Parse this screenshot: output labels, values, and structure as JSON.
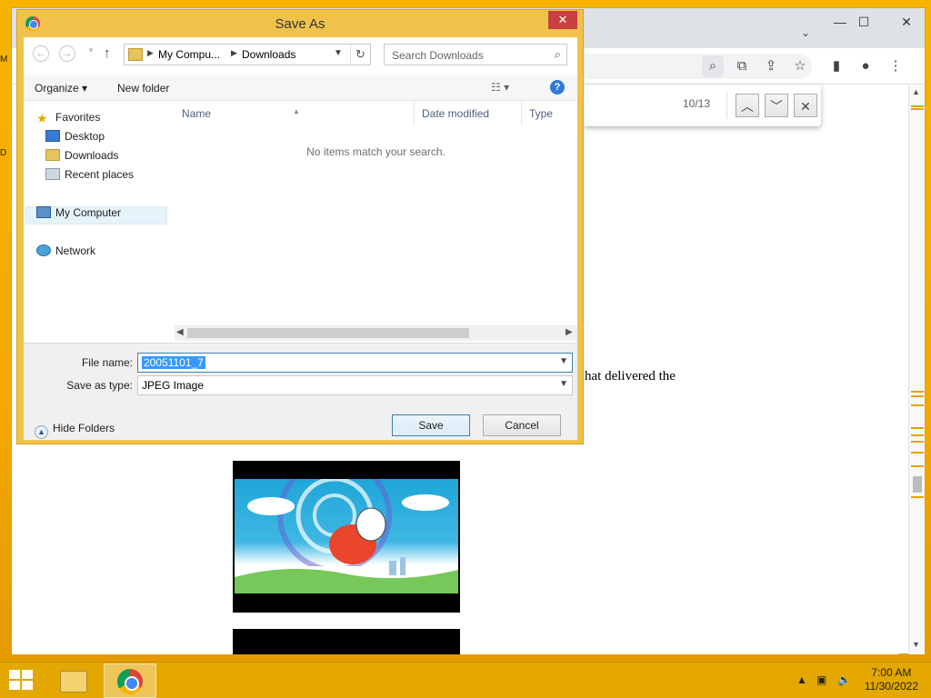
{
  "dialog": {
    "title": "Save As",
    "close_label": "✕",
    "nav": {
      "path_root": "My Compu...",
      "path_current": "Downloads",
      "search_placeholder": "Search Downloads"
    },
    "toolbar": {
      "organize_label": "Organize ▾",
      "new_folder_label": "New folder"
    },
    "nav_pane": {
      "favorites": "Favorites",
      "desktop": "Desktop",
      "downloads": "Downloads",
      "recent_places": "Recent places",
      "my_computer": "My Computer",
      "network": "Network"
    },
    "file_list": {
      "columns": [
        "Name",
        "Date modified",
        "Type"
      ],
      "empty_message": "No items match your search."
    },
    "save_bar": {
      "file_name_label": "File name:",
      "file_name_value": "20051101_7",
      "save_as_type_label": "Save as type:",
      "save_as_type_value": "JPEG Image",
      "hide_folders_label": "Hide Folders",
      "save_label": "Save",
      "cancel_label": "Cancel"
    }
  },
  "browser": {
    "find_bar": {
      "count": "10/13"
    },
    "page": {
      "text_fragment": "hat delivered the"
    }
  },
  "taskbar": {
    "time": "7:00 AM",
    "date": "11/30/2022"
  },
  "colors": {
    "desktop_bg": "#f5a800",
    "accent_blue": "#3399ff",
    "close_red": "#c94040"
  }
}
